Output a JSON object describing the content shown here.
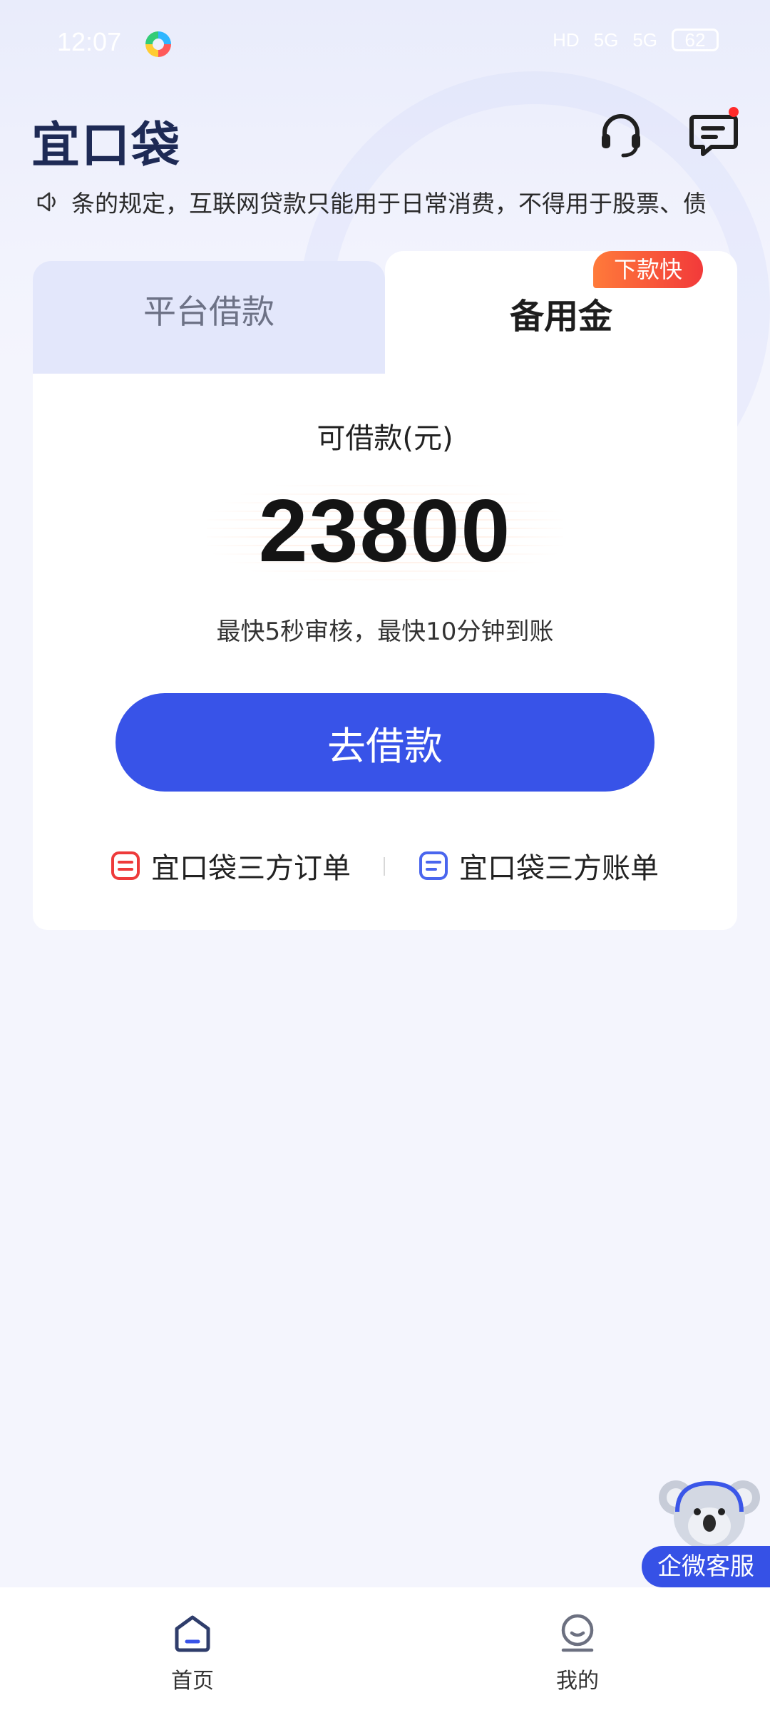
{
  "status_bar": {
    "time": "12:07",
    "indicators": [
      "HD",
      "5G",
      "5G"
    ],
    "battery": "62"
  },
  "header": {
    "logo": "宜口袋",
    "support_icon": "headset-icon",
    "message_icon": "message-icon"
  },
  "notice": {
    "text": "条的规定，互联网贷款只能用于日常消费，不得用于股票、债"
  },
  "tabs": {
    "platform_loan": "平台借款",
    "reserve_fund": "备用金",
    "badge": "下款快"
  },
  "loan": {
    "available_label": "可借款(元)",
    "amount": "23800",
    "subtext": "最快5秒审核，最快10分钟到账",
    "button": "去借款"
  },
  "links": {
    "orders": "宜口袋三方订单",
    "bills": "宜口袋三方账单"
  },
  "floating_service": {
    "label": "企微客服"
  },
  "bottom_nav": {
    "home": "首页",
    "mine": "我的"
  },
  "colors": {
    "primary": "#3853e8",
    "badge_start": "#ff7a3a",
    "badge_end": "#f23a3a",
    "logo": "#1e2a55"
  }
}
